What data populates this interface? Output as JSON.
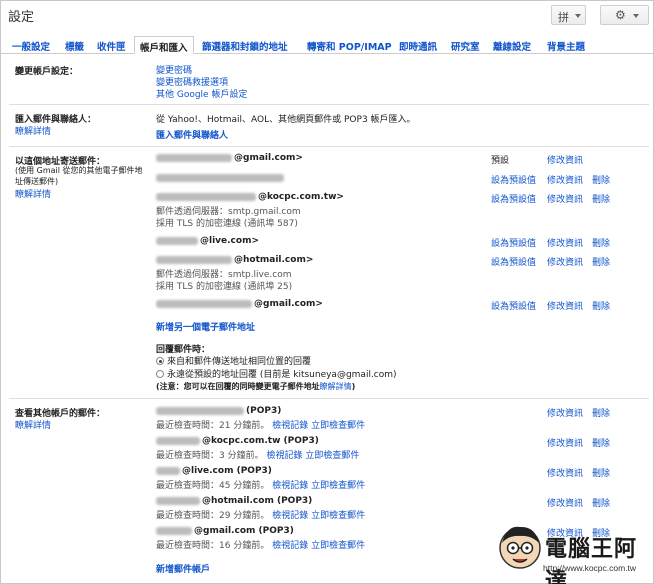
{
  "window": {
    "title": "設定",
    "lang_button": "拼"
  },
  "tabs": [
    "一般設定",
    "標籤",
    "收件匣",
    "帳戶和匯入",
    "篩選器和封鎖的地址",
    "轉寄和 POP/IMAP",
    "即時通訊",
    "研究室",
    "離線設定",
    "背景主題"
  ],
  "change_account": {
    "label": "變更帳戶設定：",
    "links": [
      "變更密碼",
      "變更密碼救援選項",
      "其他 Google 帳戶設定"
    ]
  },
  "import": {
    "label": "匯入郵件與聯絡人：",
    "learn_more": "瞭解詳情",
    "desc": "從 Yahoo!、Hotmail、AOL、其他網頁郵件或 POP3 帳戶匯入。",
    "action": "匯入郵件與聯絡人"
  },
  "send_as": {
    "label": "以這個地址寄送郵件：",
    "note": [
      "(使用 Gmail 從您的其他電子郵件地",
      "址傳送郵件)"
    ],
    "learn_more": "瞭解詳情",
    "entries": [
      {
        "address": "@gmail.com>",
        "lines": [],
        "status": "預設",
        "actions": [
          "修改資訊"
        ]
      },
      {
        "address": "",
        "lines": [],
        "status": "設為預設值",
        "actions": [
          "修改資訊",
          "刪除"
        ]
      },
      {
        "address": "@kocpc.com.tw>",
        "lines": [
          "郵件透過伺服器：smtp.gmail.com",
          "採用 TLS 的加密連線 (通訊埠 587)"
        ],
        "status": "設為預設值",
        "actions": [
          "修改資訊",
          "刪除"
        ]
      },
      {
        "address": "@live.com>",
        "lines": [],
        "status": "設為預設值",
        "actions": [
          "修改資訊",
          "刪除"
        ]
      },
      {
        "address": "@hotmail.com>",
        "lines": [
          "郵件透過伺服器：smtp.live.com",
          "採用 TLS 的加密連線 (通訊埠 25)"
        ],
        "status": "設為預設值",
        "actions": [
          "修改資訊",
          "刪除"
        ]
      },
      {
        "address": "@gmail.com>",
        "lines": [],
        "status": "設為預設值",
        "actions": [
          "修改資訊",
          "刪除"
        ]
      }
    ],
    "add_link": "新增另一個電子郵件地址",
    "reply_label": "回覆郵件時：",
    "reply_options": [
      {
        "text": "來自和郵件傳送地址相同位置的回覆",
        "selected": true
      },
      {
        "text": "永遠從預設的地址回覆 (目前是 kitsuneya@gmail.com)",
        "selected": false
      }
    ],
    "note_text": "(注意：您可以在回覆的同時變更電子郵件地址",
    "note_link": "瞭解詳情",
    "note_end": ")"
  },
  "check_mail": {
    "label": "查看其他帳戶的郵件：",
    "learn_more": "瞭解詳情",
    "accounts": [
      {
        "address": "(POP3)",
        "checked_prefix": "最近檢查時間：",
        "checked": "21 分鐘前。",
        "history": "檢視記錄",
        "check_now": "立即檢查郵件",
        "actions": [
          "修改資訊",
          "刪除"
        ]
      },
      {
        "address": "@kocpc.com.tw (POP3)",
        "checked_prefix": "最近檢查時間：",
        "checked": "3 分鐘前。",
        "history": "檢視記錄",
        "check_now": "立即檢查郵件",
        "actions": [
          "修改資訊",
          "刪除"
        ]
      },
      {
        "address": "@live.com (POP3)",
        "checked_prefix": "最近檢查時間：",
        "checked": "45 分鐘前。",
        "history": "檢視記錄",
        "check_now": "立即檢查郵件",
        "actions": [
          "修改資訊",
          "刪除"
        ]
      },
      {
        "address": "@hotmail.com (POP3)",
        "checked_prefix": "最近檢查時間：",
        "checked": "29 分鐘前。",
        "history": "檢視記錄",
        "check_now": "立即檢查郵件",
        "actions": [
          "修改資訊",
          "刪除"
        ]
      },
      {
        "address": "@gmail.com (POP3)",
        "checked_prefix": "最近檢查時間：",
        "checked": "16 分鐘前。",
        "history": "檢視記錄",
        "check_now": "立即檢查郵件",
        "actions": [
          "修改資訊",
          "刪除"
        ]
      }
    ],
    "add_link": "新增郵件帳戶"
  },
  "watermark": {
    "title": "電腦王阿達",
    "url": "http://www.kocpc.com.tw"
  }
}
